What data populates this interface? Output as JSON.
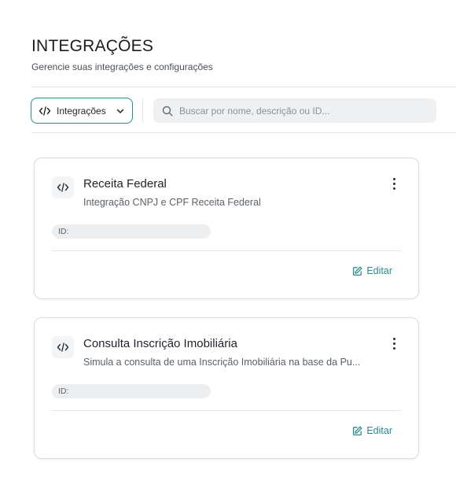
{
  "header": {
    "title": "INTEGRAÇÕES",
    "subtitle": "Gerencie suas integrações e configurações"
  },
  "toolbar": {
    "filter_label": "Integrações",
    "search_placeholder": "Buscar por nome, descrição ou ID..."
  },
  "integrations": [
    {
      "name": "Receita Federal",
      "description": "Integração CNPJ e CPF Receita Federal",
      "id_label": "ID:",
      "edit_label": "Editar"
    },
    {
      "name": "Consulta Inscrição Imobiliária",
      "description": "Simula a consulta de uma Inscrição Imobiliária na base da Pu...",
      "id_label": "ID:",
      "edit_label": "Editar"
    }
  ],
  "colors": {
    "accent": "#2b8a8f",
    "search_bg": "#eef0f1",
    "border": "#d9dcdf"
  },
  "icons": {
    "code": "code-icon",
    "chevron": "chevron-down-icon",
    "search": "search-icon",
    "menu": "more-vertical-icon",
    "edit": "edit-icon"
  }
}
